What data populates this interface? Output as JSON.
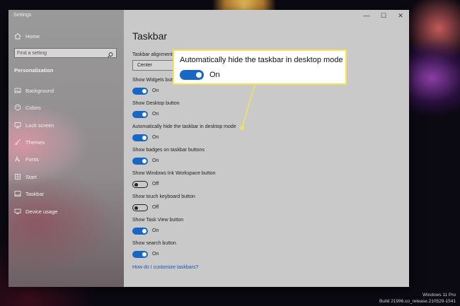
{
  "app": {
    "title": "Settings"
  },
  "window_controls": {
    "minimize": "—",
    "maximize": "☐",
    "close": "✕"
  },
  "sidebar": {
    "home_label": "Home",
    "search_placeholder": "Find a setting",
    "section_label": "Personalization",
    "items": [
      {
        "label": "Background",
        "icon": "picture-icon"
      },
      {
        "label": "Colors",
        "icon": "palette-icon"
      },
      {
        "label": "Lock screen",
        "icon": "monitor-lock-icon"
      },
      {
        "label": "Themes",
        "icon": "brush-icon"
      },
      {
        "label": "Fonts",
        "icon": "font-icon"
      },
      {
        "label": "Start",
        "icon": "start-grid-icon"
      },
      {
        "label": "Taskbar",
        "icon": "taskbar-icon"
      },
      {
        "label": "Device usage",
        "icon": "device-usage-icon"
      }
    ]
  },
  "main": {
    "page_title": "Taskbar",
    "alignment_label": "Taskbar alignment",
    "alignment_value": "Center",
    "options": [
      {
        "label": "Show Widgets button",
        "state": "On",
        "on": true
      },
      {
        "label": "Show Desktop button",
        "state": "On",
        "on": true
      },
      {
        "label": "Automatically hide the taskbar in desktop mode",
        "state": "On",
        "on": true
      },
      {
        "label": "Show badges on taskbar buttons",
        "state": "On",
        "on": true
      },
      {
        "label": "Show Windows Ink Workspace button",
        "state": "Off",
        "on": false
      },
      {
        "label": "Show touch keyboard button",
        "state": "Off",
        "on": false
      },
      {
        "label": "Show Task View button",
        "state": "On",
        "on": true
      },
      {
        "label": "Show search button",
        "state": "On",
        "on": true
      }
    ],
    "help_link": "How do I customize taskbars?"
  },
  "callout": {
    "title": "Automatically hide the taskbar in desktop mode",
    "state": "On",
    "border_color": "#f4e35a"
  },
  "colors": {
    "accent": "#1768c4",
    "link": "#1a56b0"
  },
  "watermark": {
    "line1": "Windows 11 Pro",
    "line2": "Build 21996.co_release.210529-1541"
  }
}
